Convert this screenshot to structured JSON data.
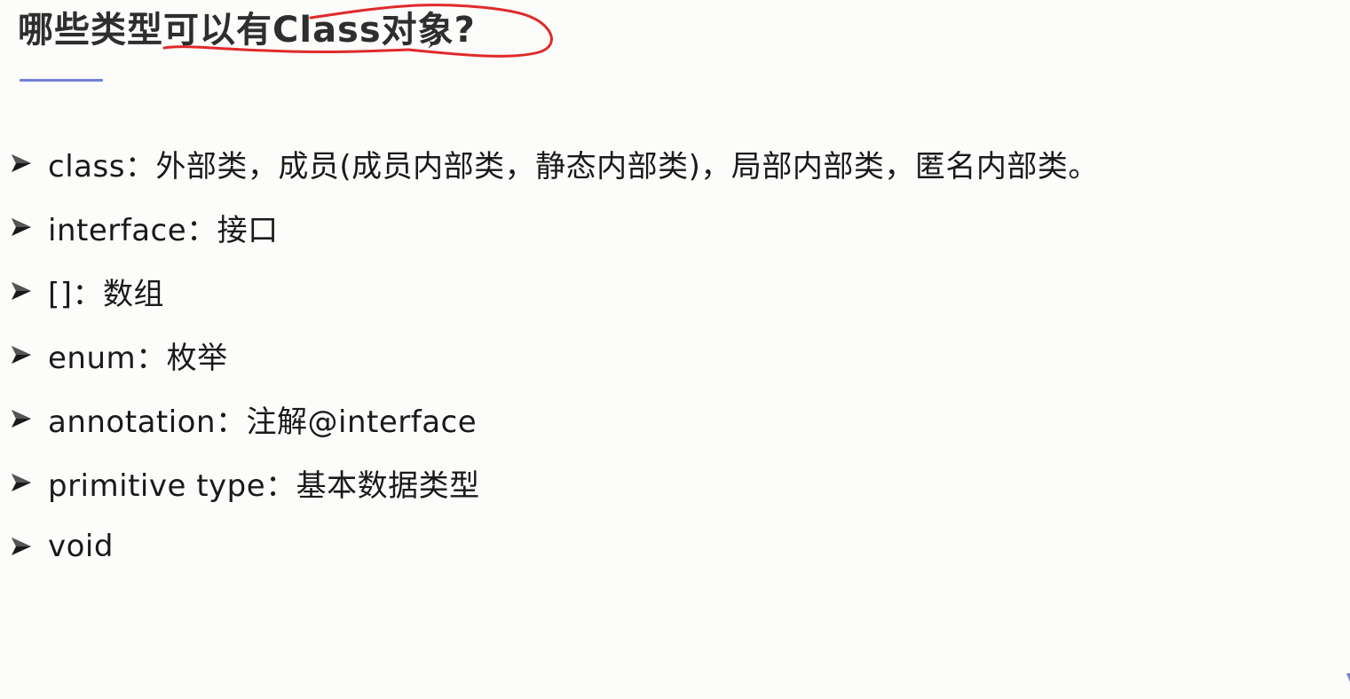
{
  "slide": {
    "title": "哪些类型可以有Class对象?",
    "accent_color": "#6f80d8",
    "annotation_color": "#e02a2a",
    "bullet_icon": "arrow-bullet-icon",
    "items": [
      {
        "text": "class：外部类，成员(成员内部类，静态内部类)，局部内部类，匿名内部类。"
      },
      {
        "text": "interface：接口"
      },
      {
        "text": "[]：数组"
      },
      {
        "text": "enum：枚举"
      },
      {
        "text": "annotation：注解@interface"
      },
      {
        "text": "primitive type：基本数据类型"
      },
      {
        "text": "void"
      }
    ]
  }
}
